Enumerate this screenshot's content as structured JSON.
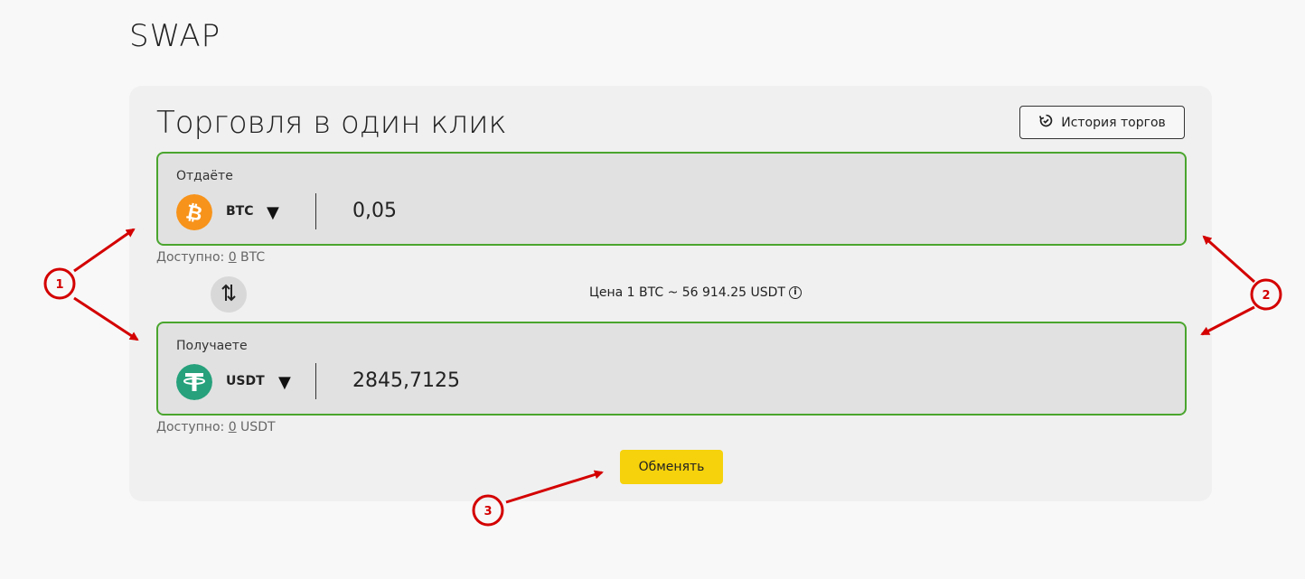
{
  "header": {
    "title": "SWAP"
  },
  "card": {
    "title": "Торговля в один клик",
    "history_button": "История торгов"
  },
  "give": {
    "label": "Отдаёте",
    "coin": "BTC",
    "amount": "0,05",
    "available_prefix": "Доступно: ",
    "available_value": "0",
    "available_unit": " BTC",
    "icon": "bitcoin-icon",
    "color": "#f7931a"
  },
  "get": {
    "label": "Получаете",
    "coin": "USDT",
    "amount": "2845,7125",
    "available_prefix": "Доступно: ",
    "available_value": "0",
    "available_unit": " USDT",
    "icon": "tether-icon",
    "color": "#26a17b"
  },
  "price": {
    "text": "Цена 1 BTC ~ 56 914.25 USDT"
  },
  "exchange_button": "Обменять",
  "annotations": {
    "one": "1",
    "two": "2",
    "three": "3"
  },
  "colors": {
    "accent": "#4aa52e",
    "button": "#f5d20b",
    "annotation": "#d40000"
  }
}
